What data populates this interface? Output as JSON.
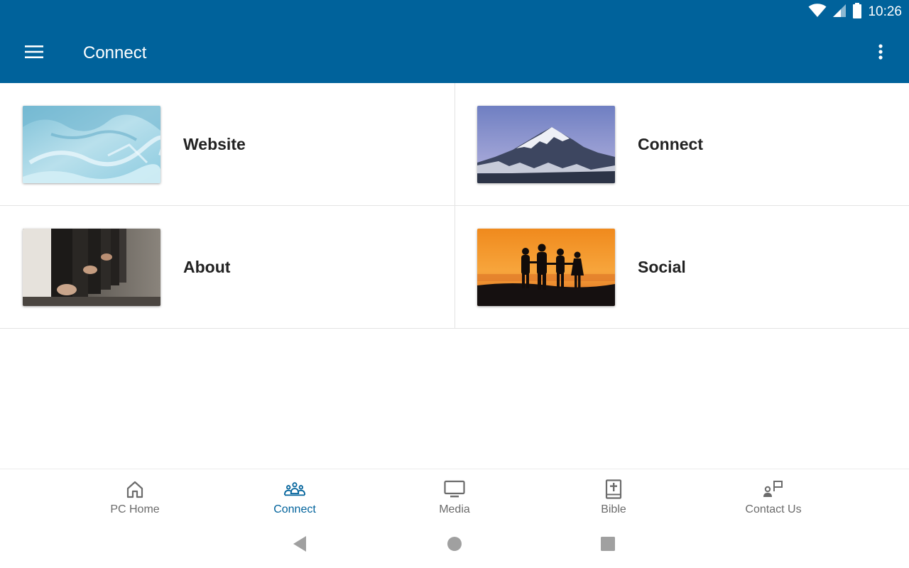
{
  "status_bar": {
    "time": "10:26",
    "icons": [
      "wifi-icon",
      "signal-icon",
      "battery-icon"
    ]
  },
  "app_bar": {
    "title": "Connect",
    "menu_icon": "hamburger-menu-icon",
    "overflow_icon": "more-vert-icon"
  },
  "tiles": [
    {
      "label": "Website",
      "image": "ice-texture-image"
    },
    {
      "label": "Connect",
      "image": "snowy-mountain-image"
    },
    {
      "label": "About",
      "image": "worship-hands-image"
    },
    {
      "label": "Social",
      "image": "sunset-silhouettes-image"
    }
  ],
  "bottom_nav": {
    "items": [
      {
        "label": "PC Home",
        "icon": "home-icon",
        "active": false
      },
      {
        "label": "Connect",
        "icon": "people-group-icon",
        "active": true
      },
      {
        "label": "Media",
        "icon": "tv-icon",
        "active": false
      },
      {
        "label": "Bible",
        "icon": "bible-icon",
        "active": false
      },
      {
        "label": "Contact Us",
        "icon": "contact-person-icon",
        "active": false
      }
    ]
  },
  "system_nav": {
    "buttons": [
      "back-button",
      "home-button",
      "recents-button"
    ]
  },
  "colors": {
    "primary": "#00629b",
    "text_dark": "#222222",
    "text_muted": "#6b6b6b",
    "divider": "#e3e3e3",
    "system_nav_icon": "#a0a0a0"
  }
}
